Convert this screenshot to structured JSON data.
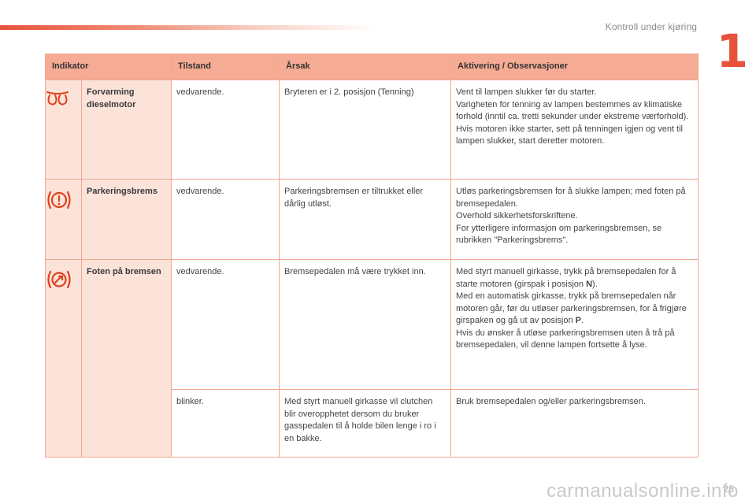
{
  "header": {
    "section_title": "Kontroll under kjøring",
    "chapter_number": "1"
  },
  "table": {
    "headers": {
      "indicator": "Indikator",
      "state": "Tilstand",
      "cause": "Årsak",
      "action": "Aktivering / Observasjoner"
    },
    "rows": [
      {
        "icon": "glow-plug-icon",
        "name": "Forvarming dieselmotor",
        "entries": [
          {
            "state": "vedvarende.",
            "cause": "Bryteren er i 2. posisjon (Tenning)",
            "action": "Vent til lampen slukker før du starter.\nVarigheten for tenning av lampen bestemmes av klimatiske forhold (inntil ca. tretti sekunder under ekstreme værforhold).\nHvis motoren ikke starter, sett på tenningen igjen og vent til lampen slukker, start deretter motoren."
          }
        ]
      },
      {
        "icon": "parking-brake-icon",
        "name": "Parkeringsbrems",
        "entries": [
          {
            "state": "vedvarende.",
            "cause": "Parkeringsbremsen er tiltrukket eller dårlig utløst.",
            "action": "Utløs parkeringsbremsen for å slukke lampen; med foten på bremsepedalen.\nOverhold sikkerhetsforskriftene.\nFor ytterligere informasjon om parkeringsbremsen, se rubrikken \"Parkeringsbrems\"."
          }
        ]
      },
      {
        "icon": "foot-on-brake-icon",
        "name": "Foten på bremsen",
        "entries": [
          {
            "state": "vedvarende.",
            "cause": "Bremsepedalen må være trykket inn.",
            "action_parts": {
              "p1": "Med styrt manuell girkasse, trykk på bremsepedalen for å starte motoren (girspak i posisjon ",
              "b1": "N",
              "p2": ").\nMed en automatisk girkasse, trykk på bremsepedalen når motoren går, før du utløser parkeringsbremsen, for å frigjøre girspaken og gå ut av posisjon ",
              "b2": "P",
              "p3": ".\nHvis du ønsker å utløse parkeringsbremsen uten å trå på bremsepedalen, vil denne lampen fortsette å lyse."
            }
          },
          {
            "state": "blinker.",
            "cause": "Med styrt manuell girkasse vil clutchen blir overopphetet dersom du bruker gasspedalen til å holde bilen lenge i ro i en bakke.",
            "action": "Bruk bremsepedalen og/eller parkeringsbremsen."
          }
        ]
      }
    ]
  },
  "footer": {
    "page_number": "25",
    "watermark": "carmanualsonline.info"
  },
  "colors": {
    "accent": "#e8523a",
    "header_fill": "#f5ab94",
    "indicator_fill": "#fbe3da",
    "border": "#f2a690"
  }
}
